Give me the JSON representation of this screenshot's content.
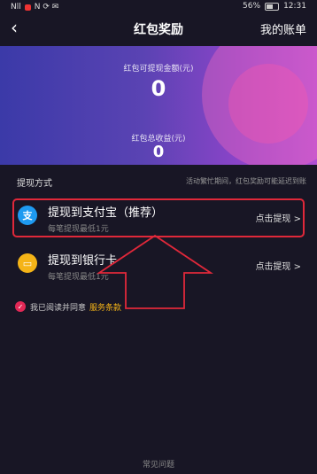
{
  "status_bar": {
    "signal": "Nll",
    "icons_right": "N ⟳ ✉",
    "battery": "56%",
    "time": "12:31"
  },
  "nav": {
    "title": "红包奖励",
    "right_label": "我的账单"
  },
  "hero": {
    "available_label": "红包可提现金额(元)",
    "available_value": "0",
    "total_label": "红包总收益(元)",
    "total_value": "0"
  },
  "method": {
    "label": "提现方式",
    "notice": "活动繁忙期间，红包奖励可能延迟到账"
  },
  "options": [
    {
      "title": "提现到支付宝（推荐）",
      "subtitle": "每笔提现最低1元",
      "action": "点击提现 >",
      "icon_glyph": "支"
    },
    {
      "title": "提现到银行卡",
      "subtitle": "每笔提现最低1元",
      "action": "点击提现 >",
      "icon_glyph": "▭"
    }
  ],
  "agreement": {
    "text": "我已阅读并同意",
    "link": "服务条款"
  },
  "footer": {
    "faq": "常见问题"
  },
  "colors": {
    "highlight_box": "#e0283a",
    "alipay_blue": "#1e9af1",
    "bank_yellow": "#f5b417",
    "check_red": "#e22856"
  }
}
